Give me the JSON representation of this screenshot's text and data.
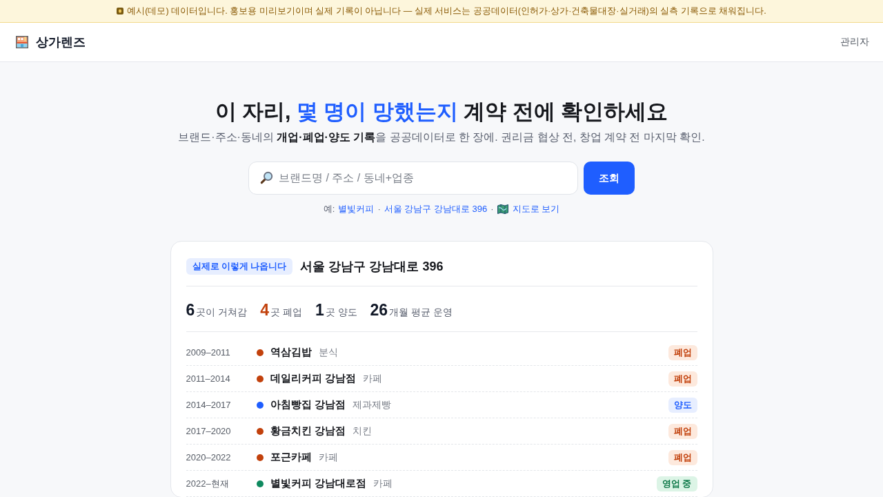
{
  "demo_banner": {
    "text": "예시(데모) 데이터입니다. 홍보용 미리보기이며 실제 기록이 아닙니다 — 실제 서비스는 공공데이터(인허가·상가·건축물대장·실거래)의 실측 기록으로 채워집니다."
  },
  "header": {
    "logo": "상가렌즈",
    "admin_link": "관리자"
  },
  "hero": {
    "headline": [
      {
        "text": "이 자리, ",
        "highlight": false
      },
      {
        "text": "몇 명이 망했는지",
        "highlight": true
      },
      {
        "text": " 계약 전에 확인하세요",
        "highlight": false
      }
    ],
    "subtitle": "브랜드·주소·동네의 **개업·폐업·양도 기록**을 공공데이터로 한 장에. 권리금 협상 전, 창업 계약 전 마지막 확인.",
    "search": {
      "placeholder": "브랜드명 / 주소 / 동네+업종",
      "button": "조회"
    },
    "examples": [
      {
        "kind": "prefix",
        "text": "예:"
      },
      {
        "kind": "link",
        "text": "별빛커피"
      },
      {
        "kind": "separator",
        "text": "·"
      },
      {
        "kind": "link",
        "text": "서울 강남구 강남대로 396"
      },
      {
        "kind": "separator",
        "text": "·"
      },
      {
        "kind": "map",
        "text": "지도로 보기"
      }
    ]
  },
  "result_card": {
    "badge": "실제로 이렇게 나옵니다",
    "address": "서울 강남구 강남대로 396",
    "stats": [
      {
        "number": "6",
        "suffix": "곳이 거쳐감",
        "color": "#111827"
      },
      {
        "number": "4",
        "suffix": "곳 폐업",
        "color": "#c2410c"
      },
      {
        "number": "1",
        "suffix": "곳 양도",
        "color": "#111827"
      },
      {
        "number": "26",
        "suffix": "개월 평균 운영",
        "color": "#111827"
      }
    ],
    "history": [
      {
        "period": "2009–2011",
        "name": "역삼김밥",
        "category": "분식",
        "status": "폐업",
        "kind": "closed",
        "color": "#c2410c"
      },
      {
        "period": "2011–2014",
        "name": "데일리커피 강남점",
        "category": "카페",
        "status": "폐업",
        "kind": "closed",
        "color": "#c2410c"
      },
      {
        "period": "2014–2017",
        "name": "아침빵집 강남점",
        "category": "제과제빵",
        "status": "양도",
        "kind": "transfer",
        "color": "#1f5eff"
      },
      {
        "period": "2017–2020",
        "name": "황금치킨 강남점",
        "category": "치킨",
        "status": "폐업",
        "kind": "closed",
        "color": "#c2410c"
      },
      {
        "period": "2020–2022",
        "name": "포근카페",
        "category": "카페",
        "status": "폐업",
        "kind": "closed",
        "color": "#c2410c"
      },
      {
        "period": "2022–현재",
        "name": "별빛커피 강남대로점",
        "category": "카페",
        "status": "영업 중",
        "kind": "open",
        "color": "#0f8a5f"
      }
    ]
  }
}
